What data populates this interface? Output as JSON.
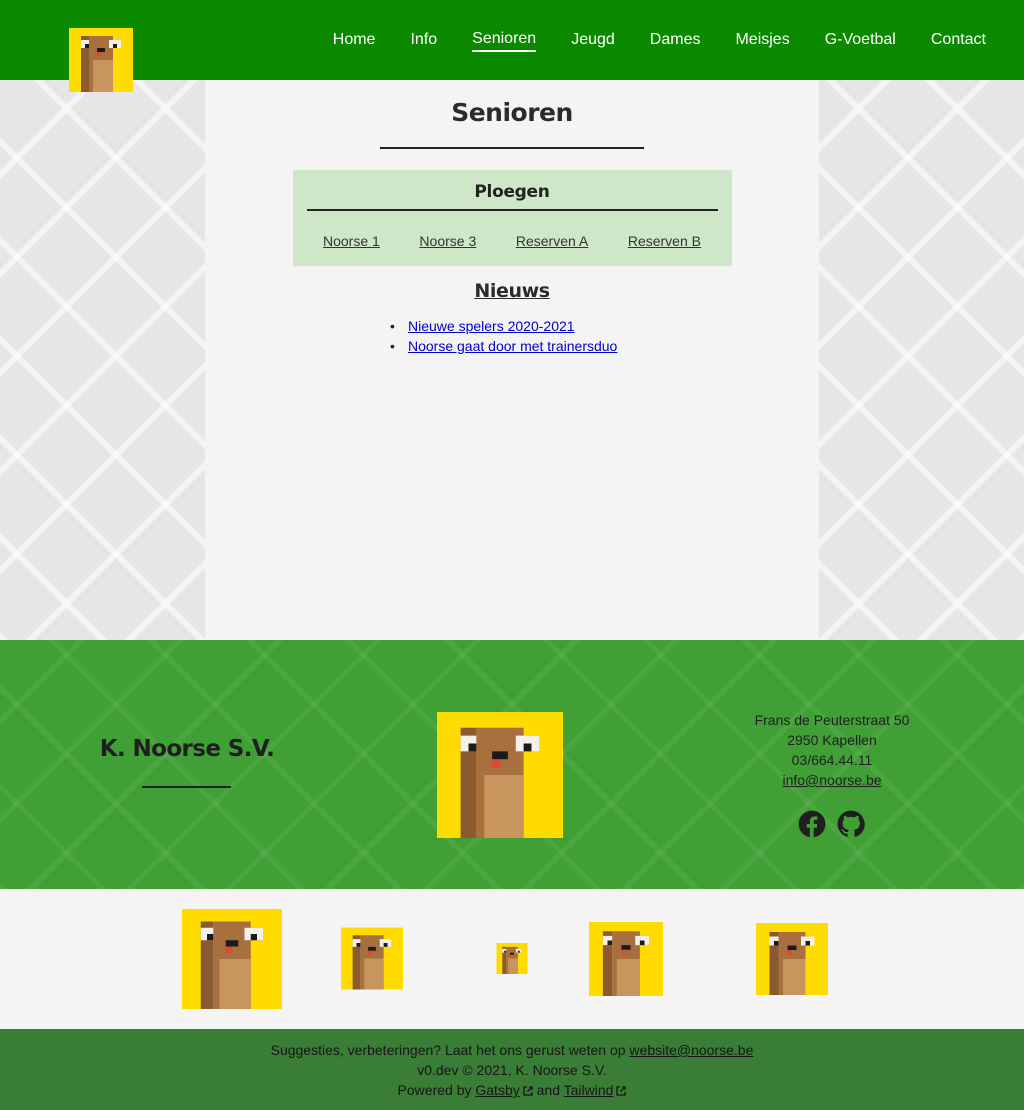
{
  "nav": {
    "items": [
      {
        "label": "Home",
        "active": false
      },
      {
        "label": "Info",
        "active": false
      },
      {
        "label": "Senioren",
        "active": true
      },
      {
        "label": "Jeugd",
        "active": false
      },
      {
        "label": "Dames",
        "active": false
      },
      {
        "label": "Meisjes",
        "active": false
      },
      {
        "label": "G-Voetbal",
        "active": false
      },
      {
        "label": "Contact",
        "active": false
      }
    ]
  },
  "main": {
    "title": "Senioren",
    "teams": {
      "title": "Ploegen",
      "items": [
        "Noorse 1",
        "Noorse 3",
        "Reserven A",
        "Reserven B"
      ]
    },
    "news": {
      "title": "Nieuws",
      "items": [
        "Nieuwe spelers 2020-2021",
        "Noorse gaat door met trainersduo"
      ]
    }
  },
  "footer": {
    "club_name": "K. Noorse S.V.",
    "address": {
      "street": "Frans de Peuterstraat 50",
      "city": "2950 Kapellen",
      "phone": "03/664.44.11",
      "email": "info@noorse.be"
    },
    "socials": [
      "facebook-icon",
      "github-icon"
    ]
  },
  "bottom": {
    "suggest_text": "Suggesties, verbeteringen? Laat het ons gerust weten op ",
    "suggest_email": "website@noorse.be",
    "version_text": "v0.dev © 2021, K. Noorse S.V.",
    "powered_text": "Powered by ",
    "gatsby_label": "Gatsby",
    "and_text": " and ",
    "tailwind_label": "Tailwind"
  },
  "colors": {
    "header": "#0b8a00",
    "footer": "#40a036",
    "bottom": "#3a7d37",
    "teams_box": "#cde7c8",
    "mascot_yellow": "#ffdb00"
  }
}
